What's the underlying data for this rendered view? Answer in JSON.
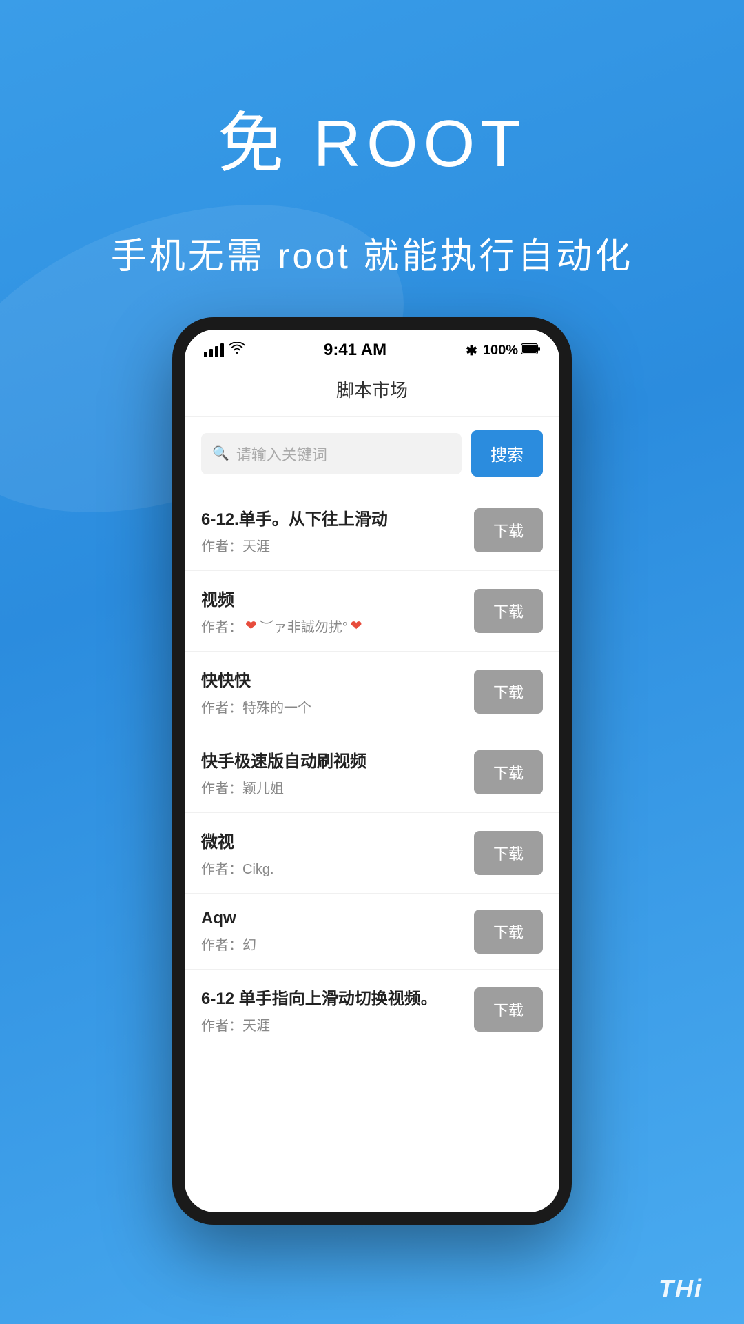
{
  "hero": {
    "title": "免 ROOT",
    "subtitle": "手机无需 root 就能执行自动化"
  },
  "phone": {
    "status_bar": {
      "time": "9:41 AM",
      "bluetooth": "✱",
      "battery": "100%"
    },
    "app_title": "脚本市场",
    "search": {
      "placeholder": "请输入关键词",
      "button_label": "搜索"
    },
    "scripts": [
      {
        "name": "6-12.单手。从下往上滑动",
        "author": "作者：天涯",
        "download": "下载",
        "has_heart": false
      },
      {
        "name": "视频",
        "author_prefix": "作者：",
        "author_text": "♥ ︶ァ非誠勿扰°♥",
        "download": "下载",
        "has_heart": true
      },
      {
        "name": "快快快",
        "author": "作者：特殊的一个",
        "download": "下载",
        "has_heart": false
      },
      {
        "name": "快手极速版自动刷视频",
        "author": "作者：颖儿姐",
        "download": "下载",
        "has_heart": false
      },
      {
        "name": "微视",
        "author": "作者：Cikg.",
        "download": "下载",
        "has_heart": false
      },
      {
        "name": "Aqw",
        "author": "作者：幻",
        "download": "下载",
        "has_heart": false
      },
      {
        "name": "6-12 单手指向上滑动切换视频。",
        "author": "作者：天涯",
        "download": "下载",
        "has_heart": false
      }
    ]
  },
  "bottom_text": "THi"
}
